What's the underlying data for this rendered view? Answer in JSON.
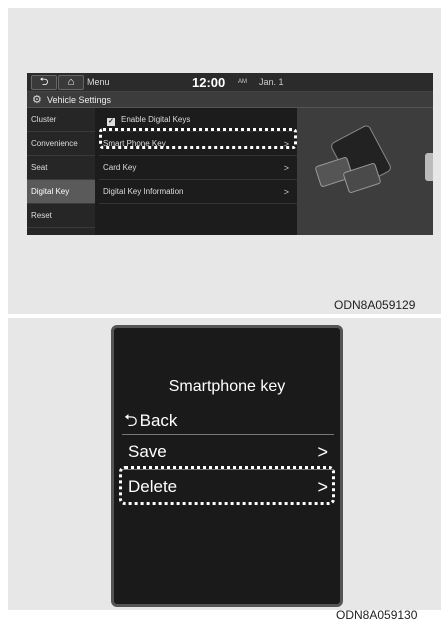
{
  "panel1": {
    "topbar": {
      "back_icon": "back-arrow-icon",
      "home_icon": "home-icon",
      "menu_label": "Menu",
      "time": "12:00",
      "ampm": "AM",
      "date": "Jan. 1"
    },
    "title_icon": "gear-icon",
    "title": "Vehicle Settings",
    "sidebar": [
      "Cluster",
      "Convenience",
      "Seat",
      "Digital Key",
      "Reset"
    ],
    "sidebar_active": "Digital Key",
    "list": {
      "enable_label": "Enable Digital Keys",
      "enable_checked": true,
      "items": [
        "Smart Phone Key",
        "Card Key",
        "Digital Key Information"
      ]
    },
    "highlighted_item": "Smart Phone Key",
    "reference": "ODN8A059129"
  },
  "panel2": {
    "title": "Smartphone key",
    "back_label": "Back",
    "items": [
      "Save",
      "Delete"
    ],
    "highlighted_item": "Delete",
    "reference": "ODN8A059130"
  },
  "colors": {
    "screen_bg": "#1c1c1c",
    "active_item": "#5a5a5a",
    "highlight": "#ffffff",
    "panel_bg": "#e7e7e7"
  }
}
